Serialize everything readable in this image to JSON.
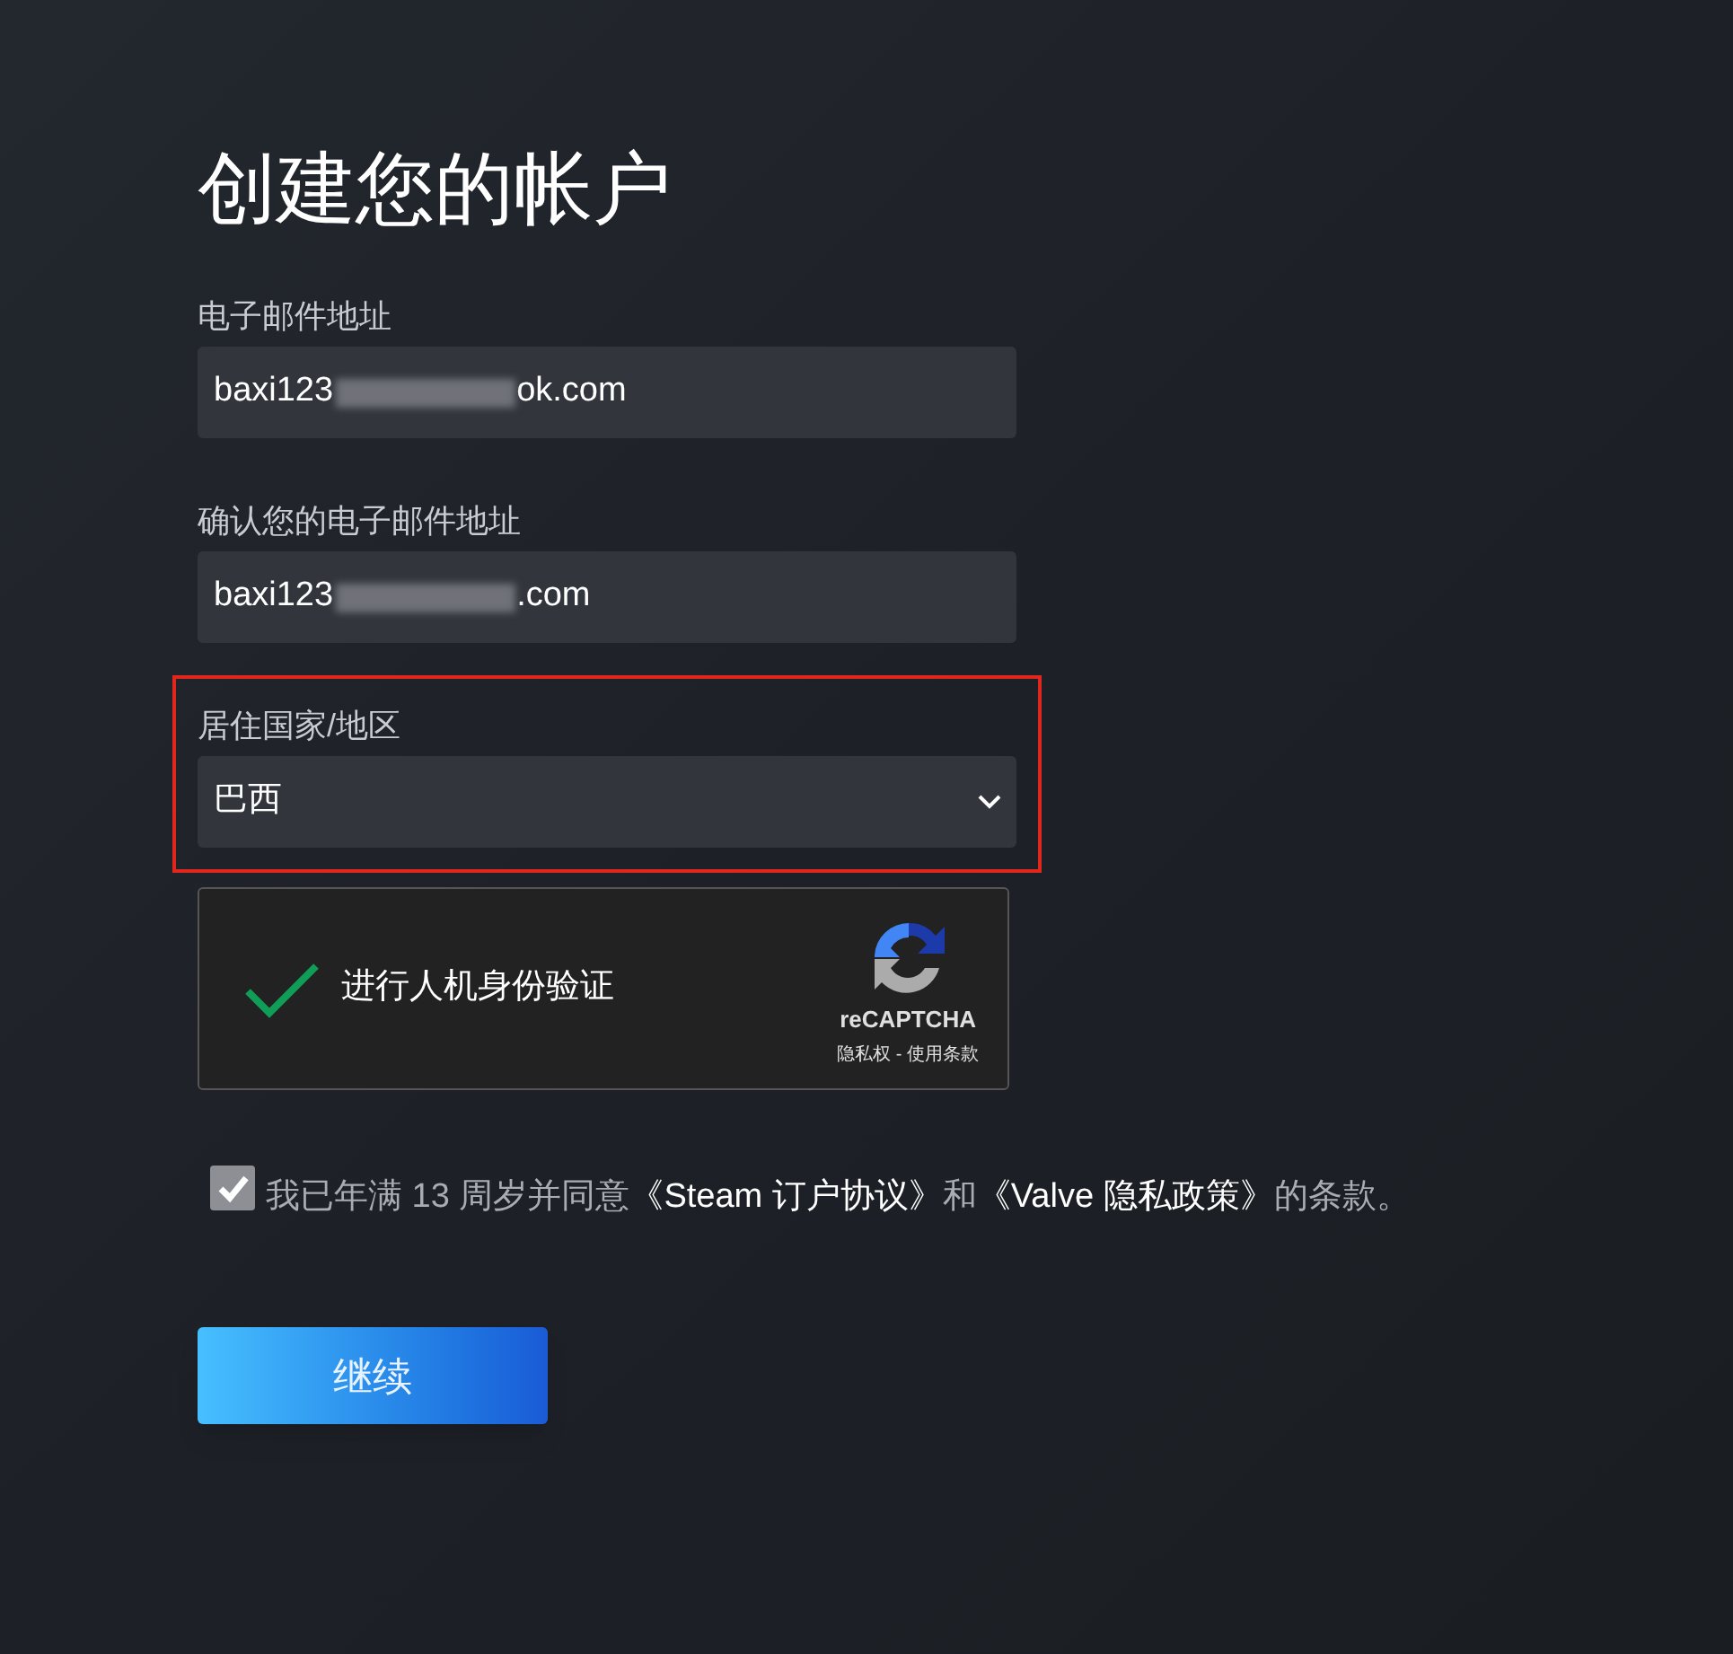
{
  "title": "创建您的帐户",
  "fields": [
    {
      "kind": "text",
      "label": "电子邮件地址",
      "value_start": "baxi123",
      "value_end": "ok.com",
      "obscured": true,
      "highlighted": false
    },
    {
      "kind": "text",
      "label": "确认您的电子邮件地址",
      "value_start": "baxi123",
      "value_end": ".com",
      "obscured": true,
      "highlighted": false
    },
    {
      "kind": "select",
      "label": "居住国家/地区",
      "value": "巴西",
      "highlighted": true
    }
  ],
  "captcha": {
    "checked": true,
    "label": "进行人机身份验证",
    "brand": "reCAPTCHA",
    "links": "隐私权 - 使用条款"
  },
  "agreement": {
    "checked": true,
    "parts": [
      {
        "kind": "text",
        "text": "我已年满 13 周岁并同意"
      },
      {
        "kind": "link",
        "text": "《Steam 订户协议》"
      },
      {
        "kind": "text",
        "text": "和"
      },
      {
        "kind": "link",
        "text": "《Valve 隐私政策》"
      },
      {
        "kind": "text",
        "text": "的条款。"
      }
    ]
  },
  "continue_button": "继续"
}
